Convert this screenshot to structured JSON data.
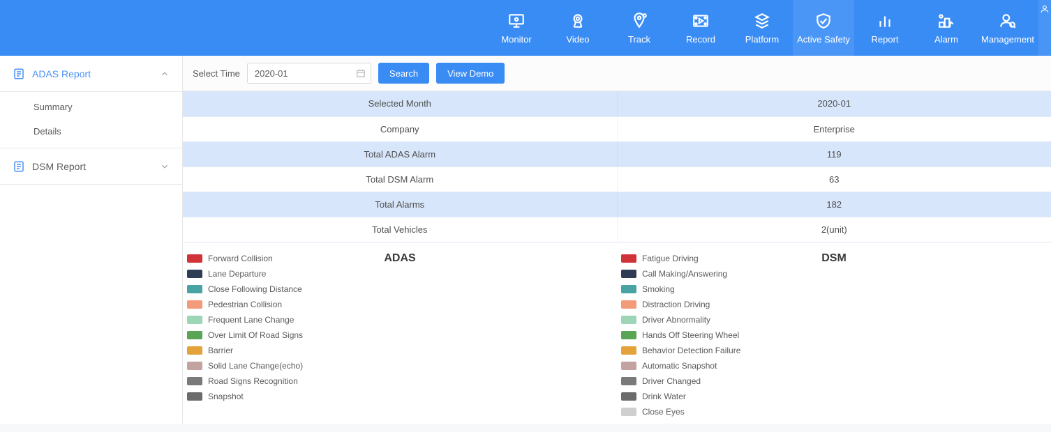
{
  "nav": [
    {
      "key": "monitor",
      "label": "Monitor"
    },
    {
      "key": "video",
      "label": "Video"
    },
    {
      "key": "track",
      "label": "Track"
    },
    {
      "key": "record",
      "label": "Record"
    },
    {
      "key": "platform",
      "label": "Platform"
    },
    {
      "key": "active-safety",
      "label": "Active Safety",
      "active": true
    },
    {
      "key": "report",
      "label": "Report"
    },
    {
      "key": "alarm",
      "label": "Alarm"
    },
    {
      "key": "management",
      "label": "Management"
    }
  ],
  "sidebar": {
    "adas": {
      "title": "ADAS Report",
      "expanded": true,
      "items": [
        "Summary",
        "Details"
      ]
    },
    "dsm": {
      "title": "DSM Report",
      "expanded": false
    }
  },
  "toolbar": {
    "select_time_label": "Select Time",
    "date_value": "2020-01",
    "search_label": "Search",
    "view_demo_label": "View Demo"
  },
  "summary_rows": [
    {
      "label": "Selected Month",
      "value": "2020-01"
    },
    {
      "label": "Company",
      "value": "Enterprise"
    },
    {
      "label": "Total ADAS Alarm",
      "value": "119"
    },
    {
      "label": "Total DSM Alarm",
      "value": "63"
    },
    {
      "label": "Total Alarms",
      "value": "182"
    },
    {
      "label": "Total Vehicles",
      "value": "2(unit)"
    }
  ],
  "legends": {
    "adas": {
      "title": "ADAS",
      "items": [
        {
          "label": "Forward Collision",
          "color": "#d13438"
        },
        {
          "label": "Lane Departure",
          "color": "#2f3d54"
        },
        {
          "label": "Close Following Distance",
          "color": "#4aa3a3"
        },
        {
          "label": "Pedestrian Collision",
          "color": "#f39a7a"
        },
        {
          "label": "Frequent Lane Change",
          "color": "#9cd6b7"
        },
        {
          "label": "Over Limit Of Road Signs",
          "color": "#5aa455"
        },
        {
          "label": "Barrier",
          "color": "#e3a33a"
        },
        {
          "label": "Solid Lane Change(echo)",
          "color": "#c2a3a0"
        },
        {
          "label": "Road Signs Recognition",
          "color": "#7a7a7a"
        },
        {
          "label": "Snapshot",
          "color": "#6b6b6b"
        }
      ]
    },
    "dsm": {
      "title": "DSM",
      "items": [
        {
          "label": "Fatigue Driving",
          "color": "#d13438"
        },
        {
          "label": "Call Making/Answering",
          "color": "#2f3d54"
        },
        {
          "label": "Smoking",
          "color": "#4aa3a3"
        },
        {
          "label": "Distraction Driving",
          "color": "#f39a7a"
        },
        {
          "label": "Driver Abnormality",
          "color": "#9cd6b7"
        },
        {
          "label": "Hands Off Steering Wheel",
          "color": "#5aa455"
        },
        {
          "label": "Behavior Detection Failure",
          "color": "#e3a33a"
        },
        {
          "label": "Automatic Snapshot",
          "color": "#c2a3a0"
        },
        {
          "label": "Driver Changed",
          "color": "#7a7a7a"
        },
        {
          "label": "Drink Water",
          "color": "#6b6b6b"
        },
        {
          "label": "Close Eyes",
          "color": "#cfcfcf"
        }
      ]
    }
  },
  "chart_data": [
    {
      "type": "bar",
      "title": "ADAS",
      "series": []
    },
    {
      "type": "bar",
      "title": "DSM",
      "series": []
    }
  ]
}
